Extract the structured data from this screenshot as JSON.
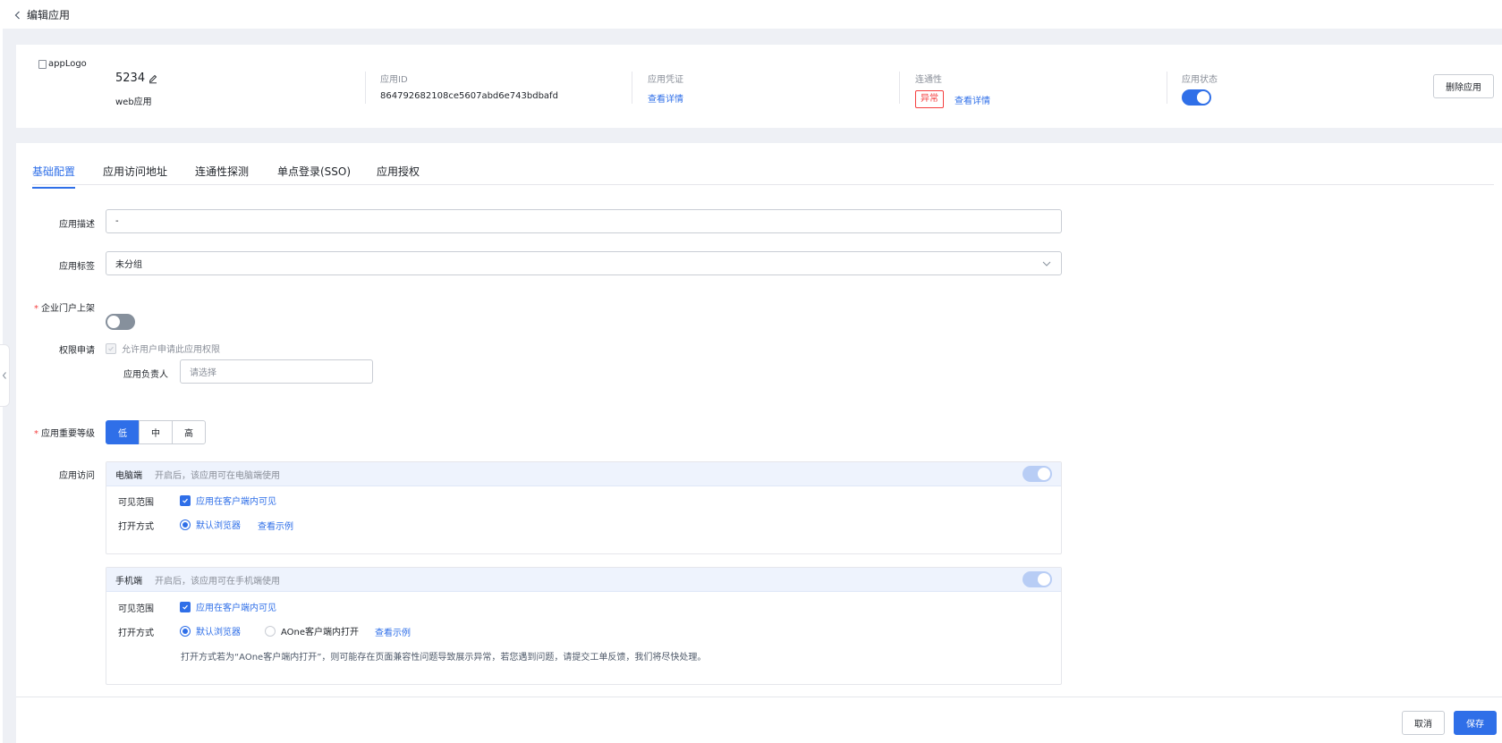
{
  "header": {
    "back_label": "编辑应用"
  },
  "app": {
    "logo_alt": "appLogo",
    "name": "5234",
    "type": "web应用",
    "id_label": "应用ID",
    "id_value": "864792682108ce5607abd6e743bdbafd",
    "credential_label": "应用凭证",
    "credential_link": "查看详情",
    "connectivity_label": "连通性",
    "connectivity_status": "异常",
    "connectivity_link": "查看详情",
    "status_label": "应用状态",
    "status_on": true,
    "delete_label": "删除应用"
  },
  "tabs": [
    "基础配置",
    "应用访问地址",
    "连通性探测",
    "单点登录(SSO)",
    "应用授权"
  ],
  "active_tab": 0,
  "form": {
    "desc_label": "应用描述",
    "desc_value": "-",
    "tag_label": "应用标签",
    "tag_value": "未分组",
    "portal_label": "企业门户上架",
    "portal_on": false,
    "perm_label": "权限申请",
    "perm_checkbox": "允许用户申请此应用权限",
    "owner_label": "应用负责人",
    "owner_placeholder": "请选择",
    "level_label": "应用重要等级",
    "levels": [
      "低",
      "中",
      "高"
    ],
    "level_selected": 0,
    "access_label": "应用访问"
  },
  "pc_panel": {
    "title": "电脑端",
    "hint": "开启后，该应用可在电脑端使用",
    "enabled": true,
    "visible_label": "可见范围",
    "visible_option": "应用在客户端内可见",
    "open_label": "打开方式",
    "open_option": "默认浏览器",
    "example_link": "查看示例"
  },
  "mobile_panel": {
    "title": "手机端",
    "hint": "开启后，该应用可在手机端使用",
    "enabled": true,
    "visible_label": "可见范围",
    "visible_option": "应用在客户端内可见",
    "open_label": "打开方式",
    "open_option_1": "默认浏览器",
    "open_option_2": "AOne客户端内打开",
    "example_link": "查看示例",
    "note": "打开方式若为“AOne客户端内打开”，则可能存在页面兼容性问题导致展示异常，若您遇到问题，请提交工单反馈，我们将尽快处理。"
  },
  "footer": {
    "cancel_label": "取消",
    "save_label": "保存"
  },
  "colors": {
    "accent": "#2f6fe8",
    "danger": "#f53f3f",
    "background": "#eef0f5"
  }
}
